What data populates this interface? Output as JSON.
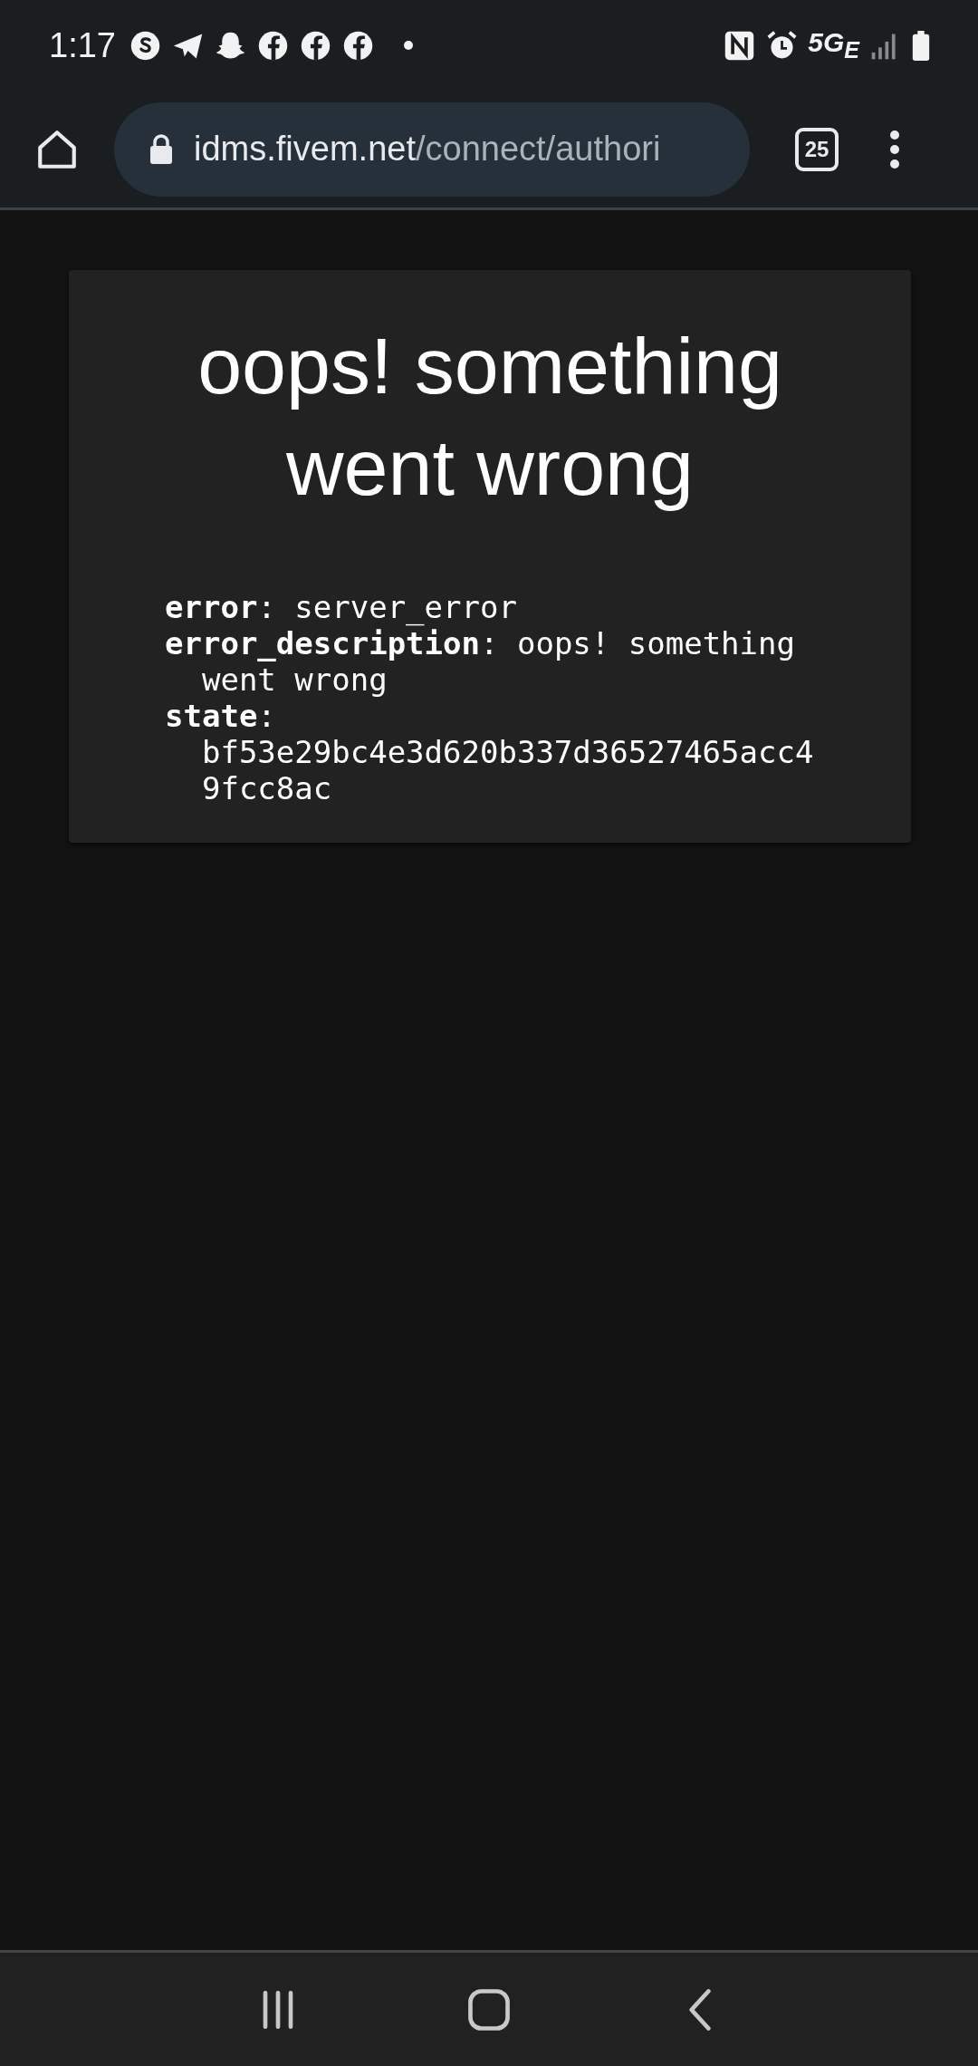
{
  "status_bar": {
    "time": "1:17",
    "network": "5G$_{E}$"
  },
  "browser": {
    "url_host": "idms.fivem.net",
    "url_path": "/connect/authori",
    "tab_count": "25"
  },
  "error_card": {
    "title": "oops! something went wrong",
    "details": [
      {
        "text": "**error**: server_error"
      },
      {
        "text": "**error_description**: oops! something went wrong"
      },
      {
        "text": "**state**: bf53e29bc4e3d620b337d36527465acc49fcc8ac"
      }
    ]
  }
}
